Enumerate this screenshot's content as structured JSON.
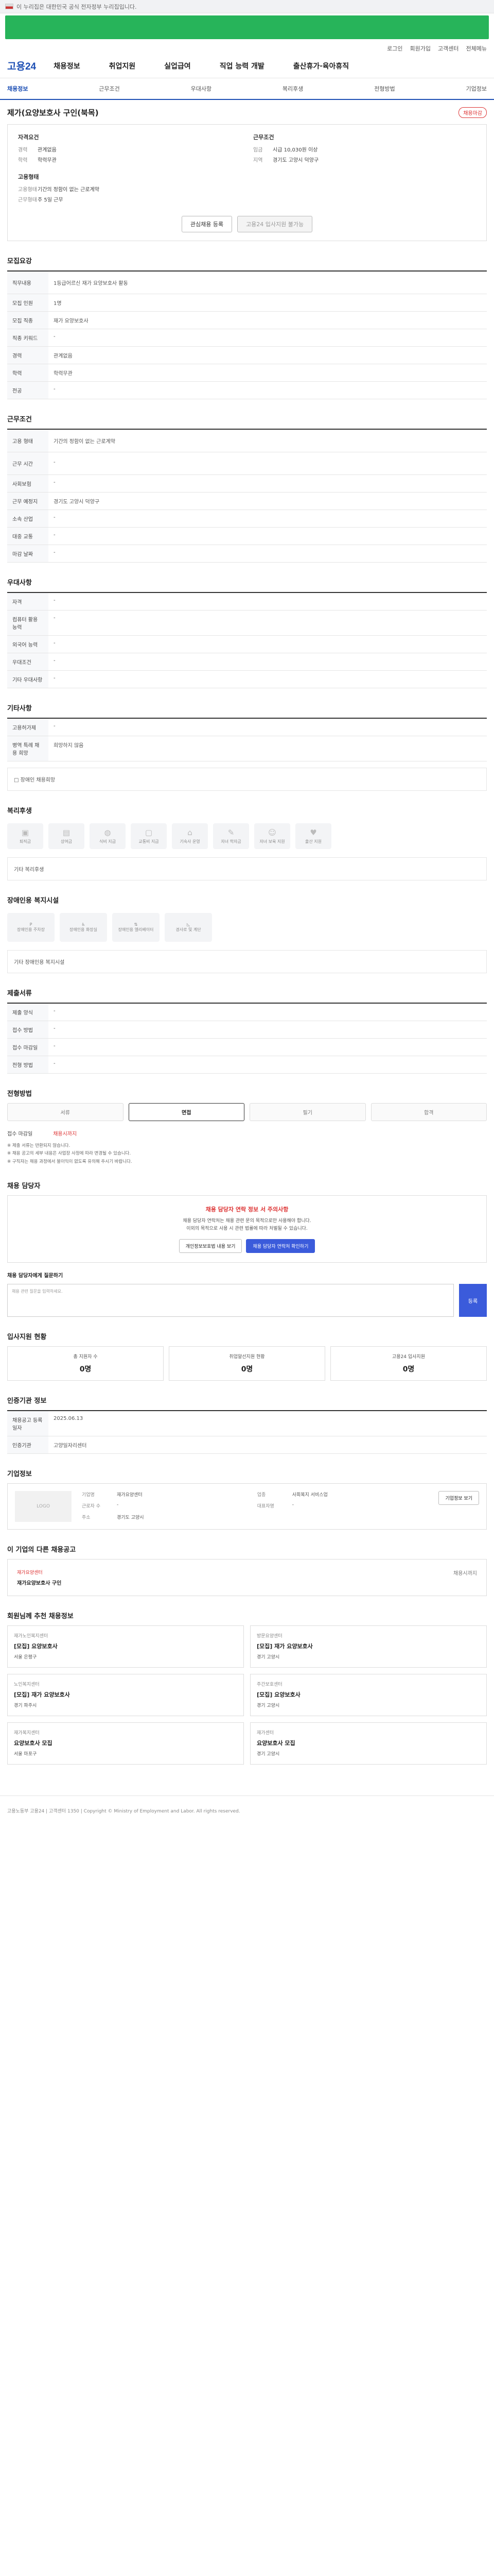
{
  "notice": "이 누리집은 대한민국 공식 전자정부 누리집입니다.",
  "util": [
    "로그인",
    "회원가입",
    "고객센터",
    "전체메뉴"
  ],
  "logo": "고용24",
  "gnb": [
    "채용정보",
    "취업지원",
    "실업급여",
    "직업 능력 개발",
    "출산휴가·육아휴직"
  ],
  "subnav": [
    "채용정보",
    "근무조건",
    "우대사항",
    "복리후생",
    "전형방법",
    "기업정보"
  ],
  "title": "제가(요양보호사 구인(북목)",
  "badge": "채용마감",
  "summary": {
    "left_title": "자격요건",
    "left": [
      [
        "경력",
        "관계없음"
      ],
      [
        "학력",
        "학력무관"
      ]
    ],
    "left2_title": "고용형태",
    "left2": [
      [
        "고용형태",
        "기간의 정함이 없는 근로계약"
      ],
      [
        "근무형태",
        "주 5일 근무"
      ]
    ],
    "right_title": "근무조건",
    "right": [
      [
        "임금",
        "시급 10,030원 이상"
      ],
      [
        "지역",
        "경기도 고양시 덕양구"
      ]
    ],
    "btn1": "관심채용 등록",
    "btn2": "고용24 입사지원 불가능"
  },
  "recruit": {
    "title": "모집요강",
    "rows": [
      [
        "직무내용",
        "1등급어르신 재가 요양보호사 활동"
      ],
      [
        "모집 인원",
        "1명"
      ],
      [
        "모집 직종",
        "재가 요양보호사"
      ],
      [
        "직종 키워드",
        "-"
      ],
      [
        "경력",
        "관계없음"
      ],
      [
        "학력",
        "학력무관"
      ],
      [
        "전공",
        "-"
      ]
    ]
  },
  "work": {
    "title": "근무조건",
    "rows": [
      [
        "고용 형태",
        "기간의 정함이 없는 근로계약"
      ],
      [
        "근무 시간",
        "-"
      ],
      [
        "사회보험",
        "-"
      ],
      [
        "근무 예정지",
        "경기도 고양시 덕양구"
      ],
      [
        "소속 산업",
        "-"
      ],
      [
        "대중 교통",
        "-"
      ],
      [
        "마감 날짜",
        "-"
      ]
    ]
  },
  "pref": {
    "title": "우대사항",
    "rows": [
      [
        "자격",
        "-"
      ],
      [
        "컴퓨터 활용 능력",
        "-"
      ],
      [
        "외국어 능력",
        "-"
      ],
      [
        "우대조건",
        "-"
      ],
      [
        "기타 우대사항",
        "-"
      ]
    ]
  },
  "etc": {
    "title": "기타사항",
    "rows": [
      [
        "고용허가제",
        "-"
      ],
      [
        "병역 특례 채용 희망",
        "희망하지 않음"
      ]
    ],
    "check": "□ 장애인 채용희망"
  },
  "welfare": {
    "title": "복리후생",
    "items": [
      "퇴직금",
      "상여금",
      "식비 지급",
      "교통비 지급",
      "기숙사 운영",
      "자녀 학자금",
      "자녀 보육 지원",
      "출산 지원"
    ],
    "note": "기타 복리후생"
  },
  "disab": {
    "title": "장애인용 복지시설",
    "items": [
      "장애인용 주차장",
      "장애인용 화장실",
      "장애인용 엘리베이터",
      "경사로 및 계단"
    ],
    "note": "기타 장애인용 복지시설"
  },
  "apply": {
    "title": "제출서류",
    "rows": [
      [
        "제출 양식",
        "-"
      ],
      [
        "접수 방법",
        "-"
      ],
      [
        "접수 마감일",
        "-"
      ],
      [
        "전형 방법",
        "-"
      ]
    ]
  },
  "process": {
    "title": "전형방법",
    "steps": [
      "서류",
      "면접",
      "필기",
      "합격"
    ],
    "apply_label": "접수 마감일",
    "apply_value": "채용시까지",
    "list": [
      "※ 제출 서류는 반환되지 않습니다.",
      "※ 채용 공고의 세부 내용은 사업장 사정에 따라 변경될 수 있습니다.",
      "※ 구직자는 채용 과정에서 불이익이 없도록 유의해 주시기 바랍니다."
    ]
  },
  "manager": {
    "title": "채용 담당자",
    "warn": "채용 담당자 연락 정보 서 주의사항",
    "p1": "채용 담당자 연락처는 채용 관련 문의 목적으로만 사용해야 합니다.",
    "p2": "이외의 목적으로 사용 시 관련 법률에 따라 처벌될 수 있습니다.",
    "b1": "개인정보보호법 내용 보기",
    "b2": "채용 담당자 연락처 확인하기"
  },
  "inquiry": {
    "title": "채용 담당자에게 질문하기",
    "placeholder": "채용 관련 질문을 입력하세요.",
    "btn": "등록"
  },
  "stats": {
    "title": "입사지원 현황",
    "items": [
      [
        "총 지원자 수",
        "0명"
      ],
      [
        "취업알선지원 현황",
        "0명"
      ],
      [
        "고용24 입사지원",
        "0명"
      ]
    ]
  },
  "info": {
    "title": "인증기관 정보",
    "rows": [
      [
        "채용공고 등록일자",
        "2025.06.13"
      ],
      [
        "인증기관",
        "고양일자리센터"
      ]
    ]
  },
  "company": {
    "title": "기업정보",
    "logo": "LOGO",
    "rows": [
      [
        "기업명",
        "재가요양센터"
      ],
      [
        "업종",
        "사회복지 서비스업"
      ],
      [
        "근로자 수",
        "-"
      ],
      [
        "대표자명",
        "-"
      ],
      [
        "주소",
        "경기도 고양시"
      ]
    ],
    "btn": "기업정보 보기"
  },
  "other": {
    "title": "이 기업의 다른 채용공고",
    "company": "재가요양센터",
    "job": "재가요양보호사 구인",
    "period": "채용시까지"
  },
  "recommend": {
    "title": "회원님께 추천 채용정보",
    "cards": [
      [
        "재가노인복지센터",
        "[모집] 요양보호사",
        "서울 은평구"
      ],
      [
        "방문요양센터",
        "[모집] 재가 요양보호사",
        "경기 고양시"
      ],
      [
        "노인복지센터",
        "[모집] 재가 요양보호사",
        "경기 파주시"
      ],
      [
        "주간보호센터",
        "[모집] 요양보호사",
        "경기 고양시"
      ],
      [
        "재가복지센터",
        "요양보호사 모집",
        "서울 마포구"
      ],
      [
        "재가센터",
        "요양보호사 모집",
        "경기 고양시"
      ]
    ]
  },
  "footer": "고용노동부 고용24 | 고객센터 1350 | Copyright © Ministry of Employment and Labor. All rights reserved."
}
